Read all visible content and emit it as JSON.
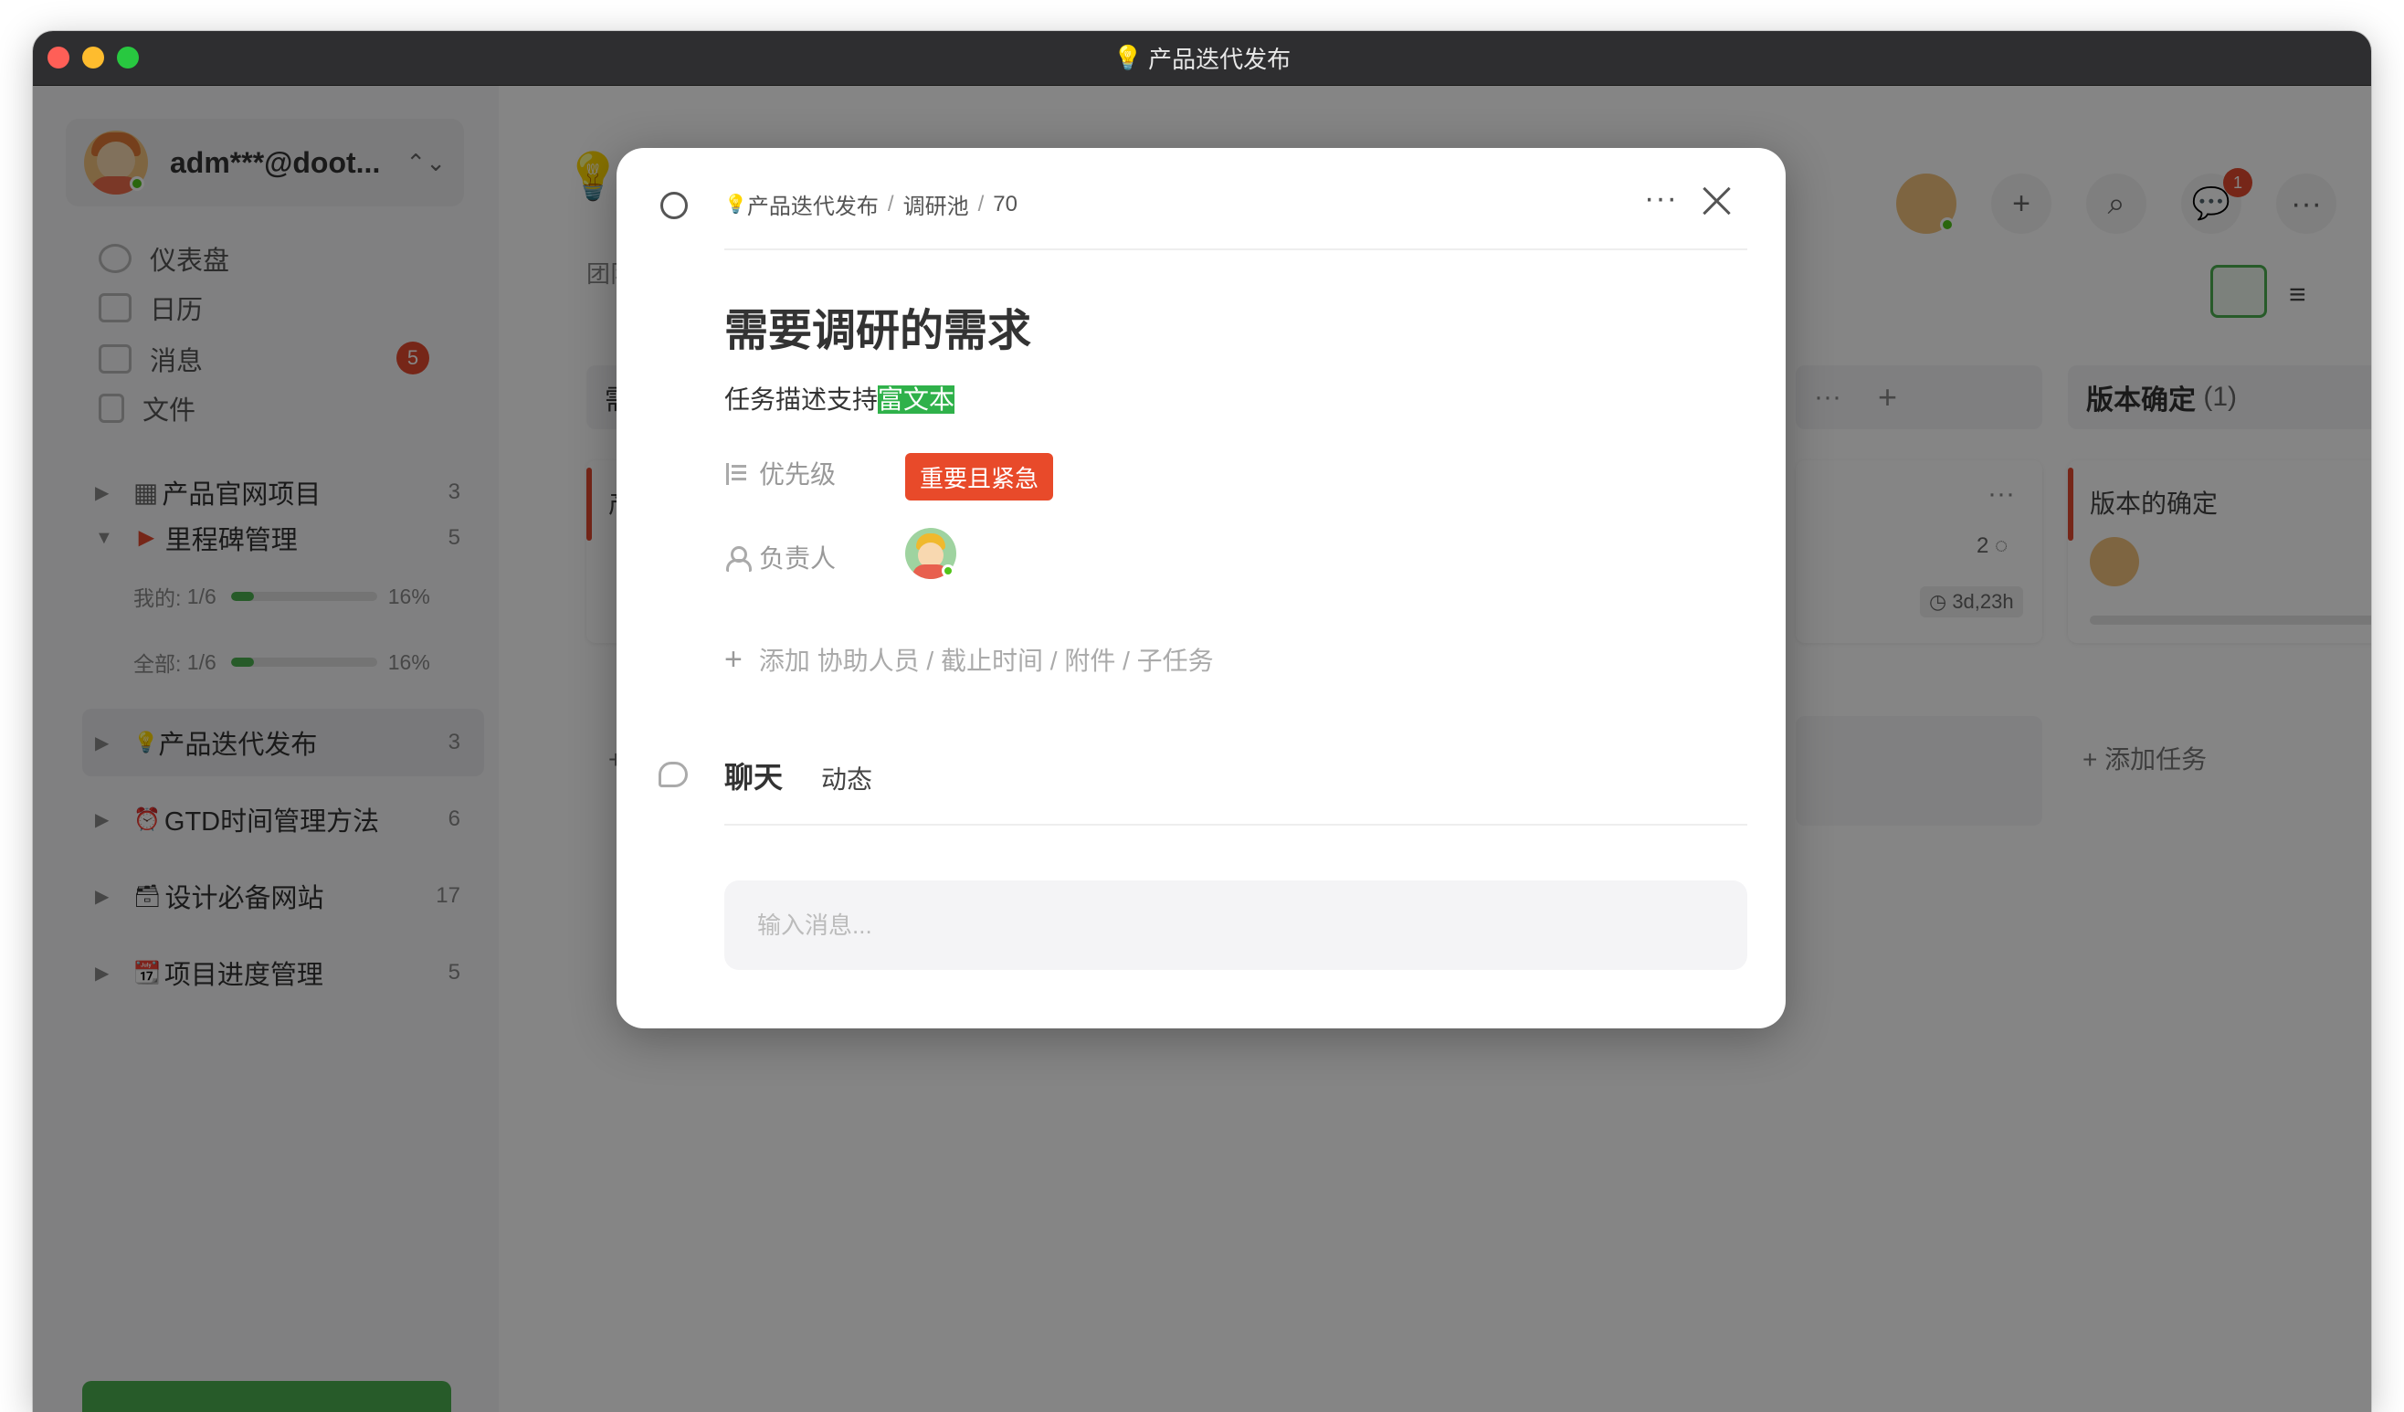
{
  "window": {
    "title": "产品迭代发布"
  },
  "sidebar": {
    "account": "adm***@doot...",
    "nav": [
      {
        "label": "仪表盘"
      },
      {
        "label": "日历"
      },
      {
        "label": "消息",
        "badge": "5"
      },
      {
        "label": "文件"
      }
    ],
    "projects": [
      {
        "name": "产品官网项目",
        "prefix": "▦",
        "count": "3"
      },
      {
        "name": "里程碑管理",
        "prefix": "►",
        "count": "5"
      },
      {
        "name": "产品迭代发布",
        "prefix": "💡",
        "count": "3"
      },
      {
        "name": "GTD时间管理方法",
        "prefix": "⏰",
        "count": "6"
      },
      {
        "name": "设计必备网站",
        "prefix": "🗃",
        "count": "17"
      },
      {
        "name": "项目进度管理",
        "prefix": "📆",
        "count": "5"
      }
    ],
    "progress": [
      {
        "label": "我的:",
        "ratio": "1/6",
        "percent": "16%",
        "value": 0.16
      },
      {
        "label": "全部:",
        "ratio": "1/6",
        "percent": "16%",
        "value": 0.16
      }
    ]
  },
  "main": {
    "team_label": "团队I",
    "notif_badge": "1",
    "columns": [
      {
        "title": "需求"
      },
      {
        "title": "版本确定",
        "count": "(1)"
      }
    ],
    "cards": [
      {
        "title": "产品"
      },
      {
        "title": "版本的确定"
      }
    ],
    "comment_count": "2",
    "time_left": "3d,23h",
    "add_task_short": "+ 添",
    "add_task": "+ 添加任务"
  },
  "modal": {
    "breadcrumb": [
      "产品迭代发布",
      "调研池",
      "70"
    ],
    "title": "需要调研的需求",
    "desc_prefix": "任务描述支持",
    "desc_highlight": "富文本",
    "priority_label": "优先级",
    "priority_value": "重要且紧急",
    "assignee_label": "负责人",
    "add_row": "添加 协助人员 / 截止时间 / 附件 / 子任务",
    "tabs": {
      "chat": "聊天",
      "activity": "动态"
    },
    "input_placeholder": "输入消息..."
  },
  "colors": {
    "accent": "#4caf50",
    "danger": "#e84a2a",
    "highlight": "#2fb14a",
    "titlebar": "#2e2e30"
  }
}
